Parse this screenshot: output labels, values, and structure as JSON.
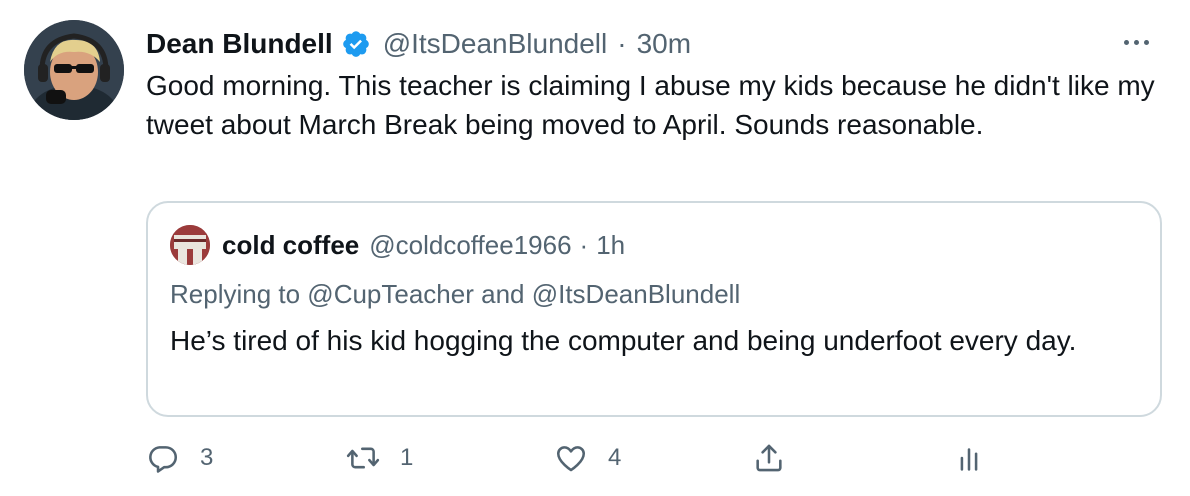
{
  "tweet": {
    "author_name": "Dean Blundell",
    "handle": "@ItsDeanBlundell",
    "separator": "·",
    "time": "30m",
    "text": "Good morning.  This teacher is claiming I abuse my kids because he didn't like my tweet about March Break being moved to April.  Sounds reasonable."
  },
  "quoted_tweet": {
    "author_name": "cold coffee",
    "handle": "@coldcoffee1966",
    "separator": "·",
    "time": "1h",
    "replying_to": "Replying to @CupTeacher and @ItsDeanBlundell",
    "text": "He’s tired of his kid hogging the computer and being underfoot every day."
  },
  "actions": {
    "reply_count": "3",
    "retweet_count": "1",
    "like_count": "4"
  },
  "colors": {
    "text": "#0f1419",
    "secondary": "#536471",
    "verified_blue": "#1d9bf0",
    "border": "#cfd9de"
  },
  "icons": [
    "verified-badge-icon",
    "more-icon",
    "reply-icon",
    "retweet-icon",
    "like-icon",
    "share-icon",
    "analytics-icon"
  ]
}
